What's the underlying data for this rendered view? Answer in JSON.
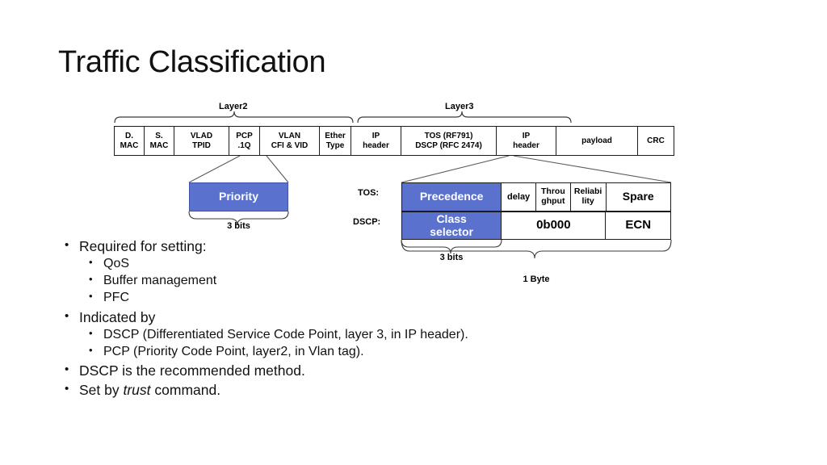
{
  "slide": {
    "title": "Traffic Classification",
    "background": "#ffffff",
    "accent_blue": "#5b71ce"
  },
  "diagram": {
    "layer_labels": {
      "layer2": "Layer2",
      "layer3": "Layer3"
    },
    "packet_cells": [
      {
        "label": "D.\nMAC"
      },
      {
        "label": "S.\nMAC"
      },
      {
        "label": "VLAD\nTPID"
      },
      {
        "label": "PCP\n.1Q"
      },
      {
        "label": "VLAN\nCFI & VID"
      },
      {
        "label": "Ether\nType"
      },
      {
        "label": "IP\nheader"
      },
      {
        "label": "TOS (RF791)\nDSCP (RFC 2474)"
      },
      {
        "label": "IP\nheader"
      },
      {
        "label": "payload"
      },
      {
        "label": "CRC"
      }
    ],
    "priority_box": {
      "label": "Priority",
      "brace_label": "3 bits"
    },
    "tos": {
      "row_label": "TOS:",
      "cells": [
        {
          "label": "Precedence",
          "highlight": true
        },
        {
          "label": "delay",
          "highlight": false
        },
        {
          "label": "Throu\nghput",
          "highlight": false
        },
        {
          "label": "Reliabi\nlity",
          "highlight": false
        },
        {
          "label": "Spare",
          "highlight": false
        }
      ]
    },
    "dscp": {
      "row_label": "DSCP:",
      "cells": [
        {
          "label": "Class\nselector",
          "highlight": true
        },
        {
          "label": "0b000",
          "highlight": false
        },
        {
          "label": "ECN",
          "highlight": false
        }
      ],
      "brace_inner_label": "3 bits",
      "brace_outer_label": "1 Byte"
    }
  },
  "bullets": [
    {
      "text": "Required for setting:",
      "children": [
        "QoS",
        "Buffer management",
        "PFC"
      ]
    },
    {
      "text": "Indicated by",
      "children": [
        "DSCP (Differentiated Service Code Point, layer 3, in IP header).",
        "PCP (Priority Code Point, layer2, in Vlan tag)."
      ]
    },
    {
      "text": "DSCP is the recommended method.",
      "children": []
    },
    {
      "text_pre": "Set by ",
      "text_italic": "trust",
      "text_post": " command.",
      "children": []
    }
  ]
}
